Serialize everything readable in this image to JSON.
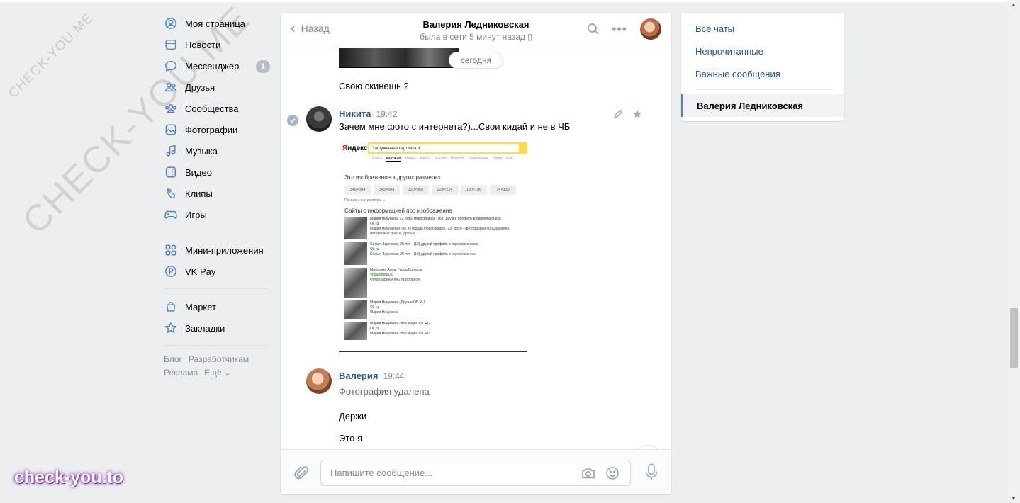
{
  "left_nav": {
    "items": [
      {
        "label": "Моя страница",
        "icon": "user-icon"
      },
      {
        "label": "Новости",
        "icon": "news-icon"
      },
      {
        "label": "Мессенджер",
        "icon": "messenger-icon",
        "badge": "1"
      },
      {
        "label": "Друзья",
        "icon": "friends-icon"
      },
      {
        "label": "Сообщества",
        "icon": "groups-icon"
      },
      {
        "label": "Фотографии",
        "icon": "photos-icon"
      },
      {
        "label": "Музыка",
        "icon": "music-icon"
      },
      {
        "label": "Видео",
        "icon": "video-icon"
      },
      {
        "label": "Клипы",
        "icon": "clips-icon"
      },
      {
        "label": "Игры",
        "icon": "games-icon"
      }
    ],
    "items2": [
      {
        "label": "Мини-приложения",
        "icon": "apps-icon"
      },
      {
        "label": "VK Pay",
        "icon": "vkpay-icon"
      }
    ],
    "items3": [
      {
        "label": "Маркет",
        "icon": "market-icon"
      },
      {
        "label": "Закладки",
        "icon": "bookmarks-icon"
      }
    ],
    "footer": {
      "blog": "Блог",
      "dev": "Разработчикам",
      "ads": "Реклама",
      "more": "Ещё ⌄"
    }
  },
  "chat": {
    "back_label": "Назад",
    "peer_name": "Валерия Ледниковская",
    "peer_status": "была в сети 5 минут назад",
    "date_pill": "сегодня",
    "messages": {
      "m0_text": "Свою скинешь ?",
      "m1_author": "Никита",
      "m1_time": "19:42",
      "m1_text": "Зачем мне фото с интернета?)...Свои кидай и не в ЧБ",
      "m2_author": "Валерия",
      "m2_time": "19:44",
      "m2_deleted": "Фотография удалена",
      "m2_text1": "Держи",
      "m2_text2": "Это я"
    },
    "attachment": {
      "logo_y": "Я",
      "logo_rest": "ндекс",
      "search_text": "Загруженная картинка ✕",
      "tabs": [
        "Поиск",
        "Картинки",
        "Видео",
        "Карты",
        "Маркет",
        "Новости",
        "Переводчик",
        "Эфир",
        "Кью"
      ],
      "sizes_title": "Это изображение в других размерах",
      "sizes": [
        "346×604",
        "345×604",
        "320×560",
        "224×224",
        "190×190",
        "74×130"
      ],
      "more_sizes": "Показать все размеры ⌄",
      "sites_title": "Сайты с информацией про изображение",
      "results": [
        {
          "title": "Мария Никулина, 22 года, Новосибирск - (63) друзей профиль в одноклассника",
          "site": "Ok.ru",
          "desc": "Мария Никулина в ОК из города Новосибирск (23) фото - фотографии пользователя, интересные факты, друзья"
        },
        {
          "title": "София Заречная, 20 лет - (19) друзей профиль в одноклассниках",
          "site": "Ok.ru",
          "desc": "София Заречная, 20 лет - (19) друзей профиль в одноклассника"
        },
        {
          "title": "Маторина Алла. Город Борисов",
          "site": "Voguegroup.ru",
          "desc": "Фотографии Аллы Маториной"
        },
        {
          "title": "Мария Никулина - Друзья OK.RU",
          "site": "Ok.ru",
          "desc": "Мария Никулина."
        },
        {
          "title": "Мария Никулина - Все видео OK.RU",
          "site": "Ok.ru",
          "desc": "Мария Никулина - Все видео OK.RU"
        }
      ]
    },
    "composer_placeholder": "Напишите сообщение..."
  },
  "right_panel": {
    "all": "Все чаты",
    "unread": "Непрочитанные",
    "important": "Важные сообщения",
    "active": "Валерия Ледниковская"
  },
  "watermarks": {
    "small": "CHECK-YOU.ME",
    "big": "CHECK-YOU.ME",
    "brand": "check-you.to"
  },
  "colors": {
    "link": "#2a5885",
    "accent": "#5181b8",
    "bg": "#edeef0"
  }
}
